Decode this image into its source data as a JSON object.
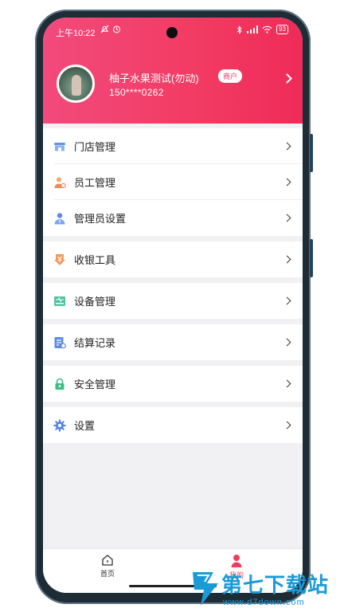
{
  "status_bar": {
    "time": "上午10:22",
    "battery": "93"
  },
  "profile": {
    "name": "柚子水果测试(勿动)",
    "badge": "商户",
    "phone": "150****0262"
  },
  "menu": {
    "items": [
      {
        "label": "门店管理",
        "icon": "store-icon"
      },
      {
        "label": "员工管理",
        "icon": "staff-icon"
      },
      {
        "label": "管理员设置",
        "icon": "admin-icon"
      },
      {
        "label": "收银工具",
        "icon": "cashier-icon"
      },
      {
        "label": "设备管理",
        "icon": "device-icon"
      },
      {
        "label": "结算记录",
        "icon": "settlement-icon"
      },
      {
        "label": "安全管理",
        "icon": "lock-icon"
      },
      {
        "label": "设置",
        "icon": "gear-icon"
      }
    ]
  },
  "bottom_nav": {
    "home_label": "首页",
    "mine_label": "我的"
  },
  "watermark": {
    "logo_text": "第七下载站",
    "url": "www.d7down.com"
  },
  "colors": {
    "accent": "#f23b62",
    "background": "#f1f1f3"
  }
}
